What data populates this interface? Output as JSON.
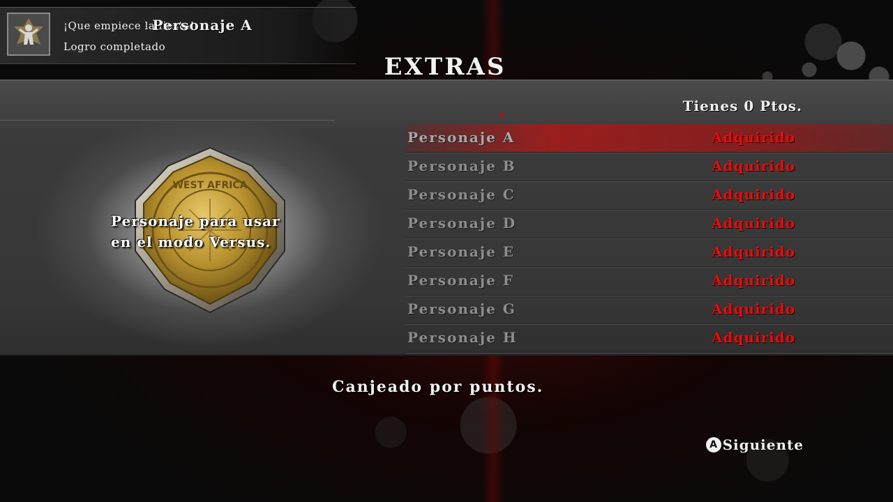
{
  "achievement": {
    "title": "¡Que empiece la fiesta!",
    "subtitle": "Logro completado",
    "icon": "trophy-figure-icon"
  },
  "screen_title": "EXTRAS",
  "selected_item": {
    "name": "Personaje A",
    "description_line1": "Personaje para usar",
    "description_line2": "en el modo Versus.",
    "image": "medal-badge-icon",
    "medal_text": "WEST AFRICA"
  },
  "points_label": "Tienes 0 Ptos.",
  "items": [
    {
      "name": "Personaje A",
      "status": "Adquirido",
      "selected": true
    },
    {
      "name": "Personaje B",
      "status": "Adquirido",
      "selected": false
    },
    {
      "name": "Personaje C",
      "status": "Adquirido",
      "selected": false
    },
    {
      "name": "Personaje D",
      "status": "Adquirido",
      "selected": false
    },
    {
      "name": "Personaje E",
      "status": "Adquirido",
      "selected": false
    },
    {
      "name": "Personaje F",
      "status": "Adquirido",
      "selected": false
    },
    {
      "name": "Personaje G",
      "status": "Adquirido",
      "selected": false
    },
    {
      "name": "Personaje H",
      "status": "Adquirido",
      "selected": false
    }
  ],
  "footer_message": "Canjeado por puntos.",
  "controls": {
    "next_button_glyph": "A",
    "next_label": "Siguiente"
  },
  "colors": {
    "status_red": "#e00e0e",
    "selection_red": "#aa1919",
    "panel_gray": "#3b3b3b"
  }
}
